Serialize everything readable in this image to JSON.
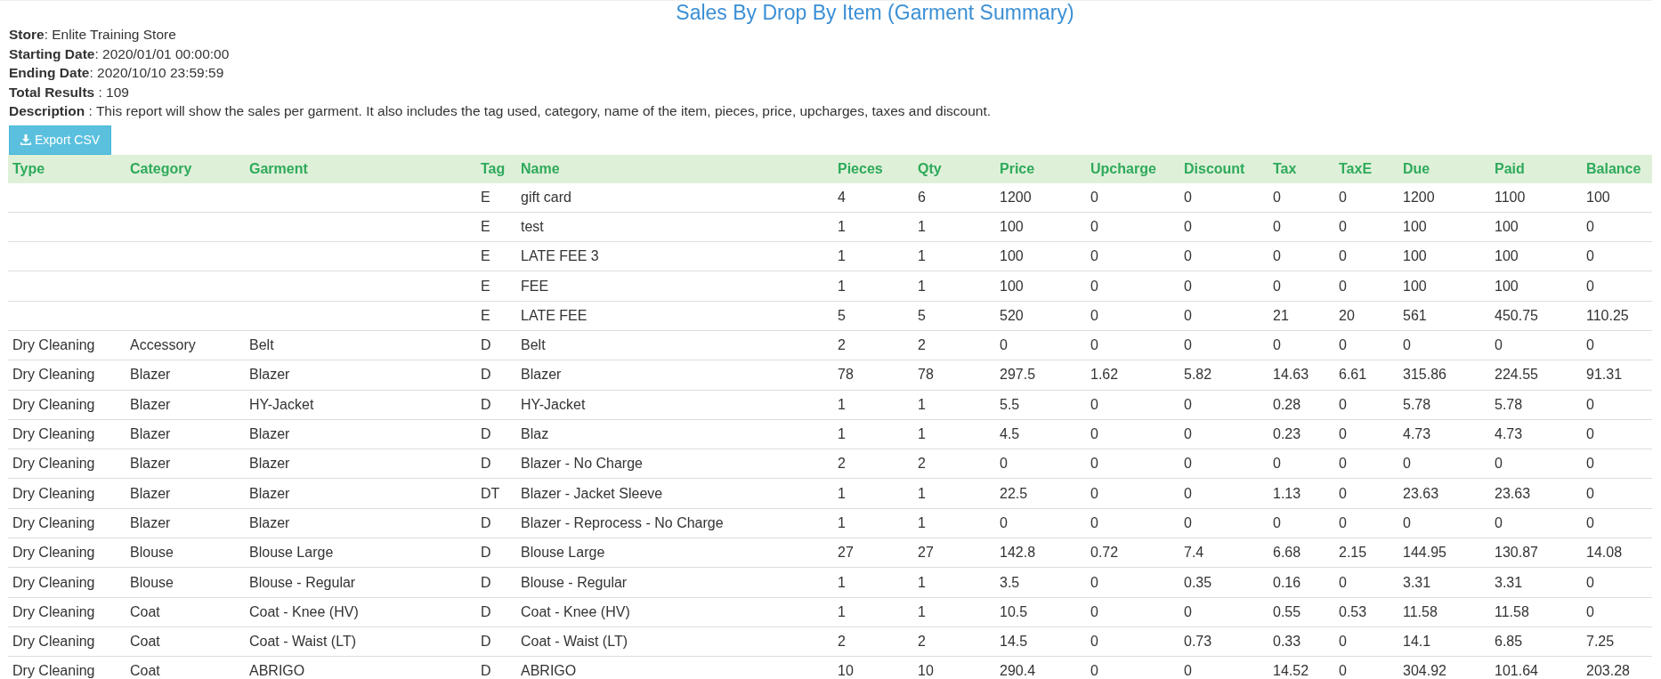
{
  "title": "Sales By Drop By Item (Garment Summary)",
  "info": [
    {
      "label": "Store",
      "sep": ": ",
      "value": "Enlite Training Store"
    },
    {
      "label": "Starting Date",
      "sep": ": ",
      "value": "2020/01/01 00:00:00"
    },
    {
      "label": "Ending Date",
      "sep": ": ",
      "value": "2020/10/10 23:59:59"
    },
    {
      "label": "Total Results",
      "sep": " : ",
      "value": "109"
    },
    {
      "label": "Description",
      "sep": " : ",
      "value": "This report will show the sales per garment. It also includes the tag used, category, name of the item, pieces, price, upcharges, taxes and discount."
    }
  ],
  "export_button": "Export CSV",
  "table": {
    "columns": [
      "Type",
      "Category",
      "Garment",
      "Tag",
      "Name",
      "Pieces",
      "Qty",
      "Price",
      "Upcharge",
      "Discount",
      "Tax",
      "TaxE",
      "Due",
      "Paid",
      "Balance"
    ],
    "rows": [
      [
        "",
        "",
        "",
        "E",
        "gift card",
        "4",
        "6",
        "1200",
        "0",
        "0",
        "0",
        "0",
        "1200",
        "1100",
        "100"
      ],
      [
        "",
        "",
        "",
        "E",
        "test",
        "1",
        "1",
        "100",
        "0",
        "0",
        "0",
        "0",
        "100",
        "100",
        "0"
      ],
      [
        "",
        "",
        "",
        "E",
        "LATE FEE 3",
        "1",
        "1",
        "100",
        "0",
        "0",
        "0",
        "0",
        "100",
        "100",
        "0"
      ],
      [
        "",
        "",
        "",
        "E",
        "FEE",
        "1",
        "1",
        "100",
        "0",
        "0",
        "0",
        "0",
        "100",
        "100",
        "0"
      ],
      [
        "",
        "",
        "",
        "E",
        "LATE FEE",
        "5",
        "5",
        "520",
        "0",
        "0",
        "21",
        "20",
        "561",
        "450.75",
        "110.25"
      ],
      [
        "Dry Cleaning",
        "Accessory",
        "Belt",
        "D",
        "Belt",
        "2",
        "2",
        "0",
        "0",
        "0",
        "0",
        "0",
        "0",
        "0",
        "0"
      ],
      [
        "Dry Cleaning",
        "Blazer",
        "Blazer",
        "D",
        "Blazer",
        "78",
        "78",
        "297.5",
        "1.62",
        "5.82",
        "14.63",
        "6.61",
        "315.86",
        "224.55",
        "91.31"
      ],
      [
        "Dry Cleaning",
        "Blazer",
        "HY-Jacket",
        "D",
        "HY-Jacket",
        "1",
        "1",
        "5.5",
        "0",
        "0",
        "0.28",
        "0",
        "5.78",
        "5.78",
        "0"
      ],
      [
        "Dry Cleaning",
        "Blazer",
        "Blazer",
        "D",
        "Blaz",
        "1",
        "1",
        "4.5",
        "0",
        "0",
        "0.23",
        "0",
        "4.73",
        "4.73",
        "0"
      ],
      [
        "Dry Cleaning",
        "Blazer",
        "Blazer",
        "D",
        "Blazer - No Charge",
        "2",
        "2",
        "0",
        "0",
        "0",
        "0",
        "0",
        "0",
        "0",
        "0"
      ],
      [
        "Dry Cleaning",
        "Blazer",
        "Blazer",
        "DT",
        "Blazer - Jacket Sleeve",
        "1",
        "1",
        "22.5",
        "0",
        "0",
        "1.13",
        "0",
        "23.63",
        "23.63",
        "0"
      ],
      [
        "Dry Cleaning",
        "Blazer",
        "Blazer",
        "D",
        "Blazer - Reprocess - No Charge",
        "1",
        "1",
        "0",
        "0",
        "0",
        "0",
        "0",
        "0",
        "0",
        "0"
      ],
      [
        "Dry Cleaning",
        "Blouse",
        "Blouse Large",
        "D",
        "Blouse Large",
        "27",
        "27",
        "142.8",
        "0.72",
        "7.4",
        "6.68",
        "2.15",
        "144.95",
        "130.87",
        "14.08"
      ],
      [
        "Dry Cleaning",
        "Blouse",
        "Blouse - Regular",
        "D",
        "Blouse - Regular",
        "1",
        "1",
        "3.5",
        "0",
        "0.35",
        "0.16",
        "0",
        "3.31",
        "3.31",
        "0"
      ],
      [
        "Dry Cleaning",
        "Coat",
        "Coat - Knee (HV)",
        "D",
        "Coat - Knee (HV)",
        "1",
        "1",
        "10.5",
        "0",
        "0",
        "0.55",
        "0.53",
        "11.58",
        "11.58",
        "0"
      ],
      [
        "Dry Cleaning",
        "Coat",
        "Coat - Waist (LT)",
        "D",
        "Coat - Waist (LT)",
        "2",
        "2",
        "14.5",
        "0",
        "0.73",
        "0.33",
        "0",
        "14.1",
        "6.85",
        "7.25"
      ],
      [
        "Dry Cleaning",
        "Coat",
        "ABRIGO",
        "D",
        "ABRIGO",
        "10",
        "10",
        "290.4",
        "0",
        "0",
        "14.52",
        "0",
        "304.92",
        "101.64",
        "203.28"
      ]
    ]
  }
}
